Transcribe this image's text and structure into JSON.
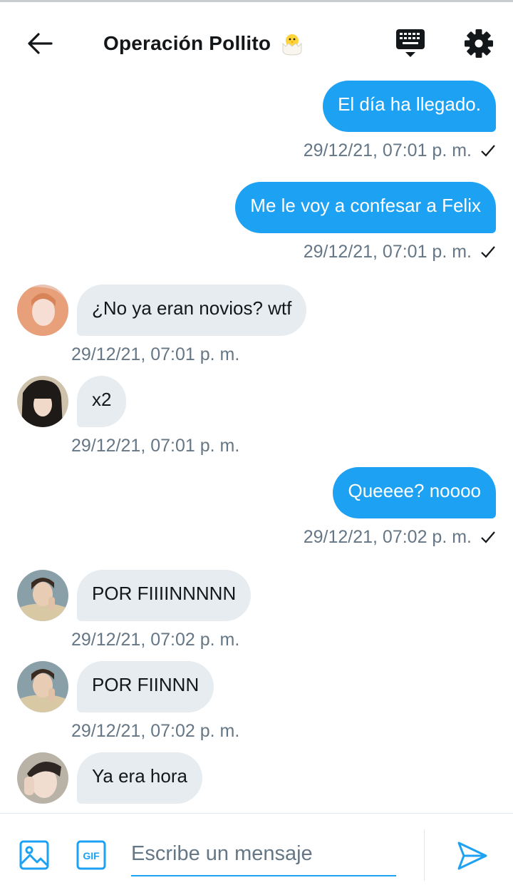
{
  "header": {
    "title": "Operación Pollito",
    "title_emoji": "chick-hatching-icon"
  },
  "messages": [
    {
      "direction": "out",
      "text": "El día ha llegado.",
      "time": "29/12/21, 07:01 p. m.",
      "status": "sent-check"
    },
    {
      "direction": "out",
      "text": "Me le voy a confesar a Felix",
      "time": "29/12/21, 07:01 p. m.",
      "status": "sent-check"
    },
    {
      "direction": "in",
      "text": "¿No ya eran novios? wtf",
      "time": "29/12/21, 07:01 p. m.",
      "avatar": "user-avatar-1"
    },
    {
      "direction": "in",
      "text": "x2",
      "time": "29/12/21, 07:01 p. m.",
      "avatar": "user-avatar-2"
    },
    {
      "direction": "out",
      "text": "Queeee? noooo",
      "time": "29/12/21, 07:02 p. m.",
      "status": "sent-check"
    },
    {
      "direction": "in",
      "text": "POR FIIIINNNNN",
      "time": "29/12/21, 07:02 p. m.",
      "avatar": "user-avatar-3"
    },
    {
      "direction": "in",
      "text": "POR FIINNN",
      "time": "29/12/21, 07:02 p. m.",
      "avatar": "user-avatar-3"
    },
    {
      "direction": "in",
      "text": "Ya era hora",
      "time": "",
      "avatar": "user-avatar-4"
    }
  ],
  "composer": {
    "placeholder": "Escribe un mensaje",
    "gif_label": "GIF"
  },
  "colors": {
    "accent": "#1da1f2",
    "incoming_bubble": "#e6ecf0",
    "meta_text": "#657786"
  }
}
